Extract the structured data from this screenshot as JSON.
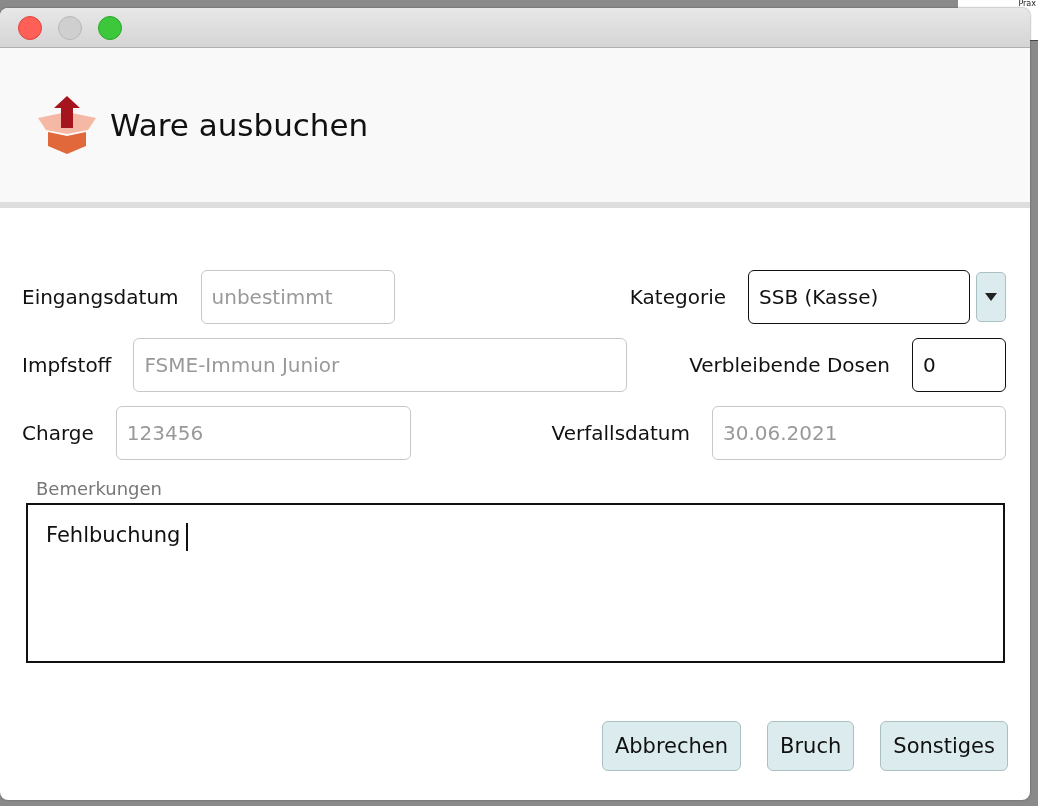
{
  "background_window": {
    "title": "Prax"
  },
  "window": {
    "title": "Ware ausbuchen"
  },
  "form": {
    "rows": [
      {
        "left": {
          "label": "Eingangsdatum",
          "value": "unbestimmt",
          "kind": "text",
          "disabled": true
        },
        "right": {
          "label": "Kategorie",
          "value": "SSB (Kasse)",
          "kind": "combo",
          "disabled": false
        }
      },
      {
        "left": {
          "label": "Impfstoff",
          "value": "FSME-Immun Junior",
          "kind": "text",
          "disabled": true
        },
        "right": {
          "label": "Verbleibende Dosen",
          "value": "0",
          "kind": "text",
          "disabled": false
        }
      },
      {
        "left": {
          "label": "Charge",
          "value": "123456",
          "kind": "text",
          "disabled": true
        },
        "right": {
          "label": "Verfallsdatum",
          "value": "30.06.2021",
          "kind": "text",
          "disabled": true
        }
      }
    ]
  },
  "remarks": {
    "label": "Bemerkungen",
    "value": "Fehlbuchung",
    "focused": true
  },
  "buttons": [
    "Abbrechen",
    "Bruch",
    "Sonstiges"
  ]
}
